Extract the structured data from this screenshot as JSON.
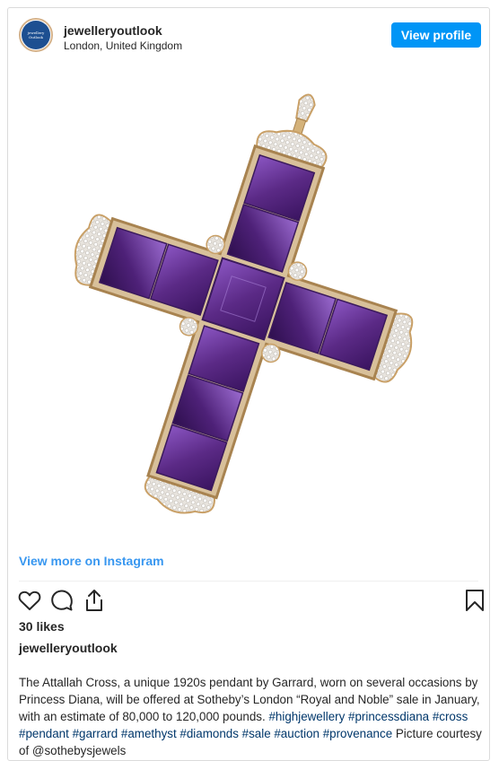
{
  "post": {
    "username": "jewelleryoutlook",
    "location": "London, United Kingdom",
    "view_profile_label": "View profile",
    "avatar_text_line1": "jewellery",
    "avatar_text_line2": "Outlook",
    "view_more_label": "View more on Instagram",
    "likes": "30 likes",
    "caption_username": "jewelleryoutlook",
    "caption_text": "The Attallah Cross, a unique 1920s pendant by Garrard, worn on several occasions by Princess Diana, will be offered at Sotheby’s London “Royal and Noble” sale in January, with an estimate of 80,000 to 120,000 pounds.",
    "hashtags": "#highjewellery #princessdiana #cross #pendant #garrard #amethyst #diamonds #sale #auction #provenance",
    "credit_text": "Picture courtesy of @sothebysjewels"
  },
  "icons": {
    "like": "heart-icon",
    "comment": "comment-icon",
    "share": "share-icon",
    "save": "bookmark-icon"
  },
  "colors": {
    "accent": "#0095f6",
    "link": "#3897f0",
    "hashtag": "#00376b",
    "amethyst": "#5b2a86",
    "gold": "#c9a067"
  }
}
